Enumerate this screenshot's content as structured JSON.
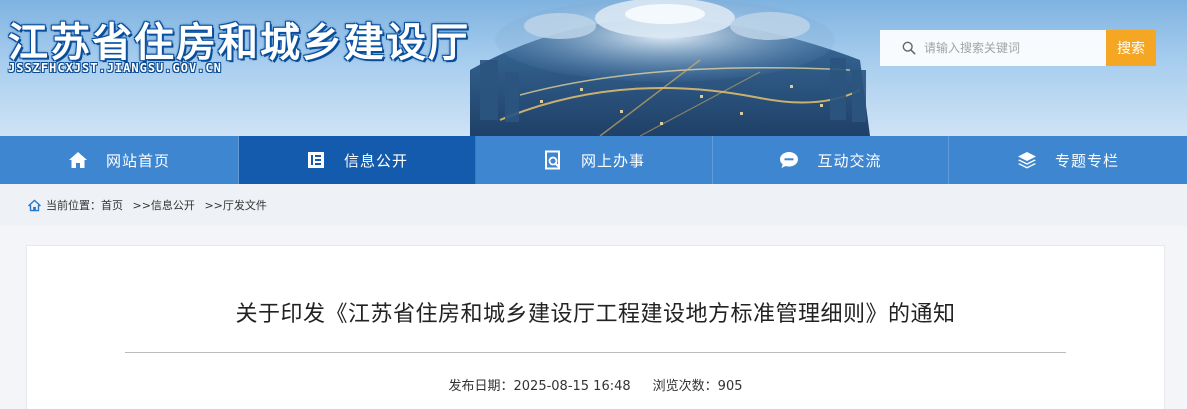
{
  "header": {
    "site_title": "江苏省住房和城乡建设厅",
    "site_domain": "JSSZFHCXJST.JIANGSU.GOV.CN",
    "search_placeholder": "请输入搜索关键词",
    "search_button": "搜索",
    "search_icon": "search-icon"
  },
  "nav": {
    "items": [
      {
        "label": "网站首页",
        "icon": "home-icon"
      },
      {
        "label": "信息公开",
        "icon": "document-icon",
        "active": true
      },
      {
        "label": "网上办事",
        "icon": "online-service-icon"
      },
      {
        "label": "互动交流",
        "icon": "chat-bubble-icon"
      },
      {
        "label": "专题专栏",
        "icon": "layers-icon"
      }
    ]
  },
  "breadcrumb": {
    "icon": "home-small-icon",
    "prefix": "当前位置：",
    "items": [
      "首页",
      ">>信息公开",
      ">>厅发文件"
    ]
  },
  "article": {
    "title": "关于印发《江苏省住房和城乡建设厅工程建设地方标准管理细则》的通知",
    "publish_label": "发布日期：",
    "publish_date": "2025-08-15 16:48",
    "views_label": "浏览次数：",
    "views": "905"
  },
  "colors": {
    "nav_bg": "#3f86d1",
    "nav_active": "#155bad",
    "search_button": "#f5a623",
    "banner_sky": "#a7cdee"
  }
}
